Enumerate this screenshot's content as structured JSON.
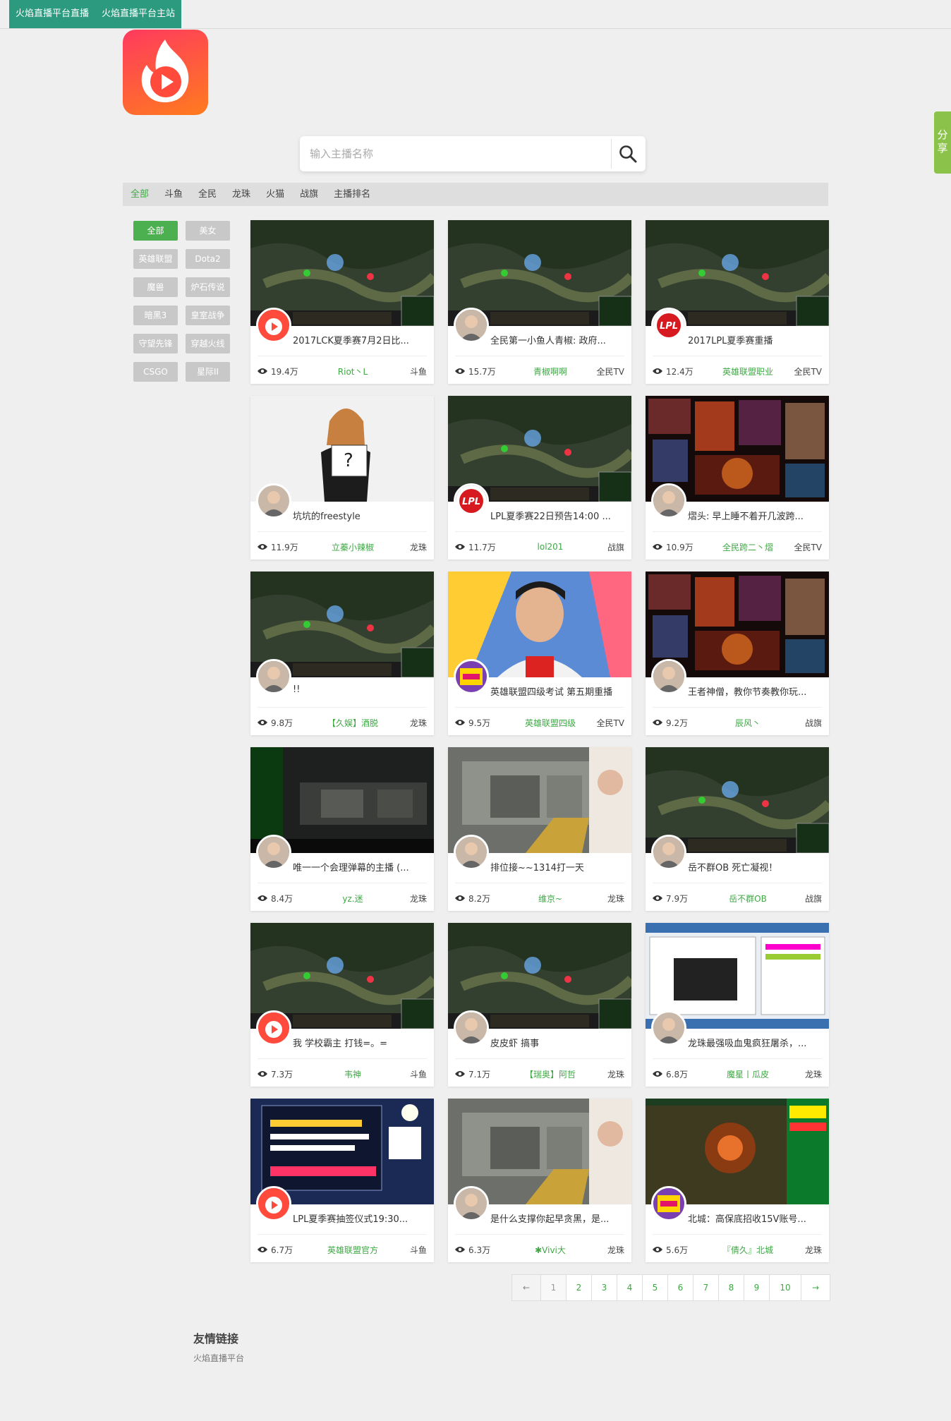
{
  "topnav": {
    "links": [
      "火焰直播平台直播",
      "火焰直播平台主站"
    ]
  },
  "share": "分享",
  "search": {
    "placeholder": "输入主播名称"
  },
  "tabs": [
    "全部",
    "斗鱼",
    "全民",
    "龙珠",
    "火猫",
    "战旗",
    "主播排名"
  ],
  "categories": [
    "全部",
    "美女",
    "英雄联盟",
    "Dota2",
    "魔兽",
    "炉石传说",
    "暗黑3",
    "皇室战争",
    "守望先锋",
    "穿越火线",
    "CSGO",
    "星际II"
  ],
  "streams": [
    {
      "title": "2017LCK夏季赛7月2日比...",
      "views": "19.4万",
      "anchor": "Riot丶L",
      "platform": "斗鱼",
      "thumb": "game",
      "avatar": "logo"
    },
    {
      "title": "全民第一小鱼人青椒: 政府...",
      "views": "15.7万",
      "anchor": "青椒啊啊",
      "platform": "全民TV",
      "thumb": "game",
      "avatar": "photo"
    },
    {
      "title": "2017LPL夏季赛重播",
      "views": "12.4万",
      "anchor": "英雄联盟职业",
      "platform": "全民TV",
      "thumb": "game",
      "avatar": "lpl"
    },
    {
      "title": "坑坑的freestyle",
      "views": "11.9万",
      "anchor": "立蓁小辣椒",
      "platform": "龙珠",
      "thumb": "light",
      "avatar": "photo"
    },
    {
      "title": "LPL夏季赛22日预告14:00 ...",
      "views": "11.7万",
      "anchor": "lol201",
      "platform": "战旗",
      "thumb": "game",
      "avatar": "lpl"
    },
    {
      "title": "熠头: 早上睡不着开几波跨...",
      "views": "10.9万",
      "anchor": "全民跨二丶熠",
      "platform": "全民TV",
      "thumb": "collage",
      "avatar": "photo"
    },
    {
      "title": "!!",
      "views": "9.8万",
      "anchor": "【久娱】酒脱",
      "platform": "龙珠",
      "thumb": "game",
      "avatar": "photo"
    },
    {
      "title": "英雄联盟四级考试 第五期重播",
      "views": "9.5万",
      "anchor": "英雄联盟四级",
      "platform": "全民TV",
      "thumb": "person",
      "avatar": "badge"
    },
    {
      "title": "王者神僧，教你节奏教你玩...",
      "views": "9.2万",
      "anchor": "辰风丶",
      "platform": "战旗",
      "thumb": "collage",
      "avatar": "photo"
    },
    {
      "title": "唯一一个会理弹幕的主播 (...",
      "views": "8.4万",
      "anchor": "yz.迷",
      "platform": "龙珠",
      "thumb": "dark",
      "avatar": "photo"
    },
    {
      "title": "排位接~~1314打一天",
      "views": "8.2万",
      "anchor": "维京~",
      "platform": "龙珠",
      "thumb": "fps",
      "avatar": "photo"
    },
    {
      "title": "岳不群OB 死亡凝视！",
      "views": "7.9万",
      "anchor": "岳不群OB",
      "platform": "战旗",
      "thumb": "game",
      "avatar": "photo"
    },
    {
      "title": "我 学校霸主 打钱=。=",
      "views": "7.3万",
      "anchor": "韦神",
      "platform": "斗鱼",
      "thumb": "game",
      "avatar": "logo"
    },
    {
      "title": "皮皮虾 搞事",
      "views": "7.1万",
      "anchor": "【瑞奥】阿哲",
      "platform": "龙珠",
      "thumb": "game",
      "avatar": "photo"
    },
    {
      "title": "龙珠最强吸血鬼疯狂屠杀，...",
      "views": "6.8万",
      "anchor": "魔星丨瓜皮",
      "platform": "龙珠",
      "thumb": "desktop",
      "avatar": "photo"
    },
    {
      "title": "LPL夏季赛抽签仪式19:30...",
      "views": "6.7万",
      "anchor": "英雄联盟官方",
      "platform": "斗鱼",
      "thumb": "banner",
      "avatar": "logo"
    },
    {
      "title": "是什么支撑你起早贪黑，是...",
      "views": "6.3万",
      "anchor": "✱Vivi大",
      "platform": "龙珠",
      "thumb": "fps",
      "avatar": "photo"
    },
    {
      "title": "北城：高保底招收15V账号...",
      "views": "5.6万",
      "anchor": "『倩久』北城",
      "platform": "龙珠",
      "thumb": "rpg",
      "avatar": "badge"
    }
  ],
  "pager": {
    "prev": "←",
    "pages": [
      "1",
      "2",
      "3",
      "4",
      "5",
      "6",
      "7",
      "8",
      "9",
      "10"
    ],
    "next": "→",
    "current": "1"
  },
  "footer": {
    "links_title": "友情链接",
    "links": [
      "火焰直播平台"
    ]
  },
  "colors": {
    "brand_green": "#2c9a7e",
    "accent_green": "#4cb050",
    "logo_red": "#ff3a5e",
    "logo_orange": "#ff7b1e"
  }
}
